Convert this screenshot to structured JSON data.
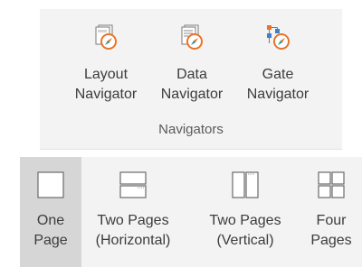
{
  "navigators": {
    "group_label": "Navigators",
    "buttons": [
      {
        "line1": "Layout",
        "line2": "Navigator",
        "icon": "layout-navigator-icon"
      },
      {
        "line1": "Data",
        "line2": "Navigator",
        "icon": "data-navigator-icon"
      },
      {
        "line1": "Gate",
        "line2": "Navigator",
        "icon": "gate-navigator-icon"
      }
    ]
  },
  "page_views": {
    "selected": "One Page",
    "buttons": [
      {
        "line1": "One",
        "line2": "Page",
        "icon": "one-page-icon"
      },
      {
        "line1": "Two Pages",
        "line2": "(Horizontal)",
        "icon": "two-pages-horizontal-icon"
      },
      {
        "line1": "Two Pages",
        "line2": "(Vertical)",
        "icon": "two-pages-vertical-icon"
      },
      {
        "line1": "Four",
        "line2": "Pages",
        "icon": "four-pages-icon"
      }
    ]
  },
  "colors": {
    "panel_bg": "#f3f3f3",
    "selected_bg": "#d6d6d6",
    "compass_orange": "#e8742a",
    "compass_teal": "#1f8f8f",
    "icon_outline": "#7a7a7a"
  }
}
